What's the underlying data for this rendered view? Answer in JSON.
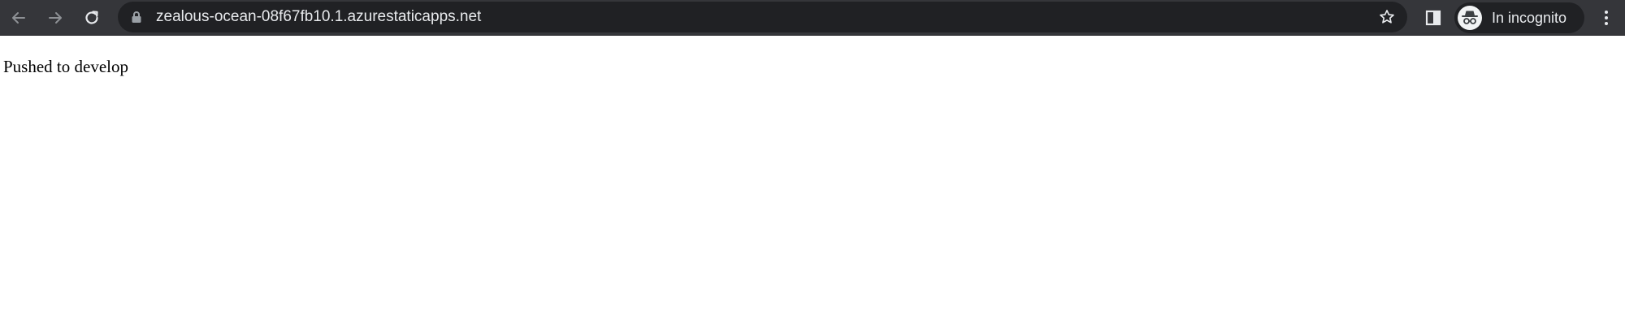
{
  "browser": {
    "url": "zealous-ocean-08f67fb10.1.azurestaticapps.net",
    "incognito_label": "In incognito",
    "icons": {
      "back": "back-arrow-icon",
      "forward": "forward-arrow-icon",
      "reload": "reload-icon",
      "lock": "lock-icon",
      "star": "star-icon",
      "side_panel": "side-panel-icon",
      "incognito": "incognito-icon",
      "menu": "kebab-menu-icon"
    },
    "colors": {
      "toolbar": "#35363a",
      "omnibox": "#202124",
      "text": "#e8eaed"
    }
  },
  "page": {
    "body_text": "Pushed to develop"
  }
}
